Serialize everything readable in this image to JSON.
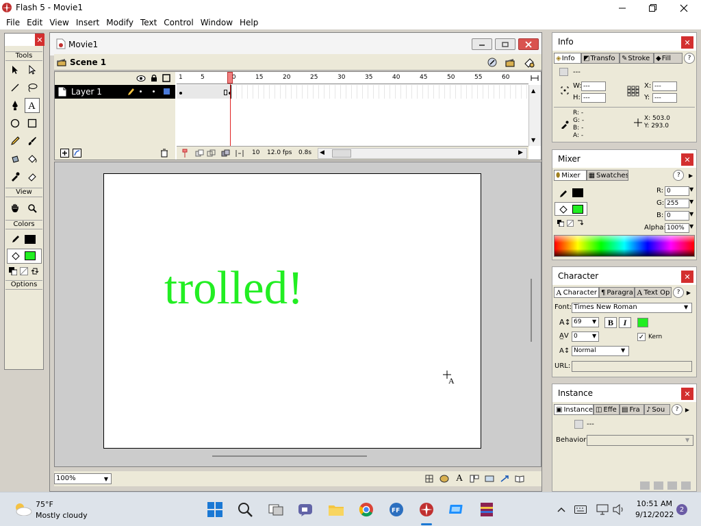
{
  "app": {
    "title": "Flash 5 - Movie1"
  },
  "menu": [
    "File",
    "Edit",
    "View",
    "Insert",
    "Modify",
    "Text",
    "Control",
    "Window",
    "Help"
  ],
  "tools": {
    "title": "Tools",
    "sections": {
      "view": "View",
      "colors": "Colors",
      "options": "Options"
    },
    "stroke_color": "#000000",
    "fill_color": "#22ee22"
  },
  "movie": {
    "title": "Movie1",
    "scene": "Scene 1",
    "layer": "Layer 1",
    "ruler_ticks": [
      "1",
      "5",
      "10",
      "15",
      "20",
      "25",
      "30",
      "35",
      "40",
      "45",
      "50",
      "55",
      "60"
    ],
    "current_frame": "10",
    "fps": "12.0 fps",
    "time": "0.8s",
    "zoom": "100%",
    "stage_text": "trolled!"
  },
  "info": {
    "title": "Info",
    "tabs": [
      "Info",
      "Transfo",
      "Stroke",
      "Fill"
    ],
    "shape": "---",
    "w_label": "W:",
    "w": "---",
    "h_label": "H:",
    "h": "---",
    "x_label": "X:",
    "x": "---",
    "y_label": "Y:",
    "y": "---",
    "r": "R: -",
    "g": "G: -",
    "b": "B: -",
    "a": "A: -",
    "cx": "X:  503.0",
    "cy": "Y:  293.0"
  },
  "mixer": {
    "title": "Mixer",
    "tabs": [
      "Mixer",
      "Swatches"
    ],
    "r_label": "R:",
    "r": "0",
    "g_label": "G:",
    "g": "255",
    "b_label": "B:",
    "b": "0",
    "alpha_label": "Alpha:",
    "alpha": "100%",
    "stroke_color": "#000000",
    "fill_color": "#22ee22"
  },
  "character": {
    "title": "Character",
    "tabs": [
      "Character",
      "Paragra",
      "Text Op"
    ],
    "font_label": "Font:",
    "font": "Times New Roman",
    "size": "69",
    "bold": "B",
    "italic": "I",
    "text_color": "#22ee22",
    "tracking": "0",
    "kern": "Kern",
    "baseline": "Normal",
    "url_label": "URL:"
  },
  "instance": {
    "title": "Instance",
    "tabs": [
      "Instance",
      "Effe",
      "Fra",
      "Sou"
    ],
    "symbol": "---",
    "behavior_label": "Behavior:"
  },
  "taskbar": {
    "temp": "75°F",
    "weather": "Mostly cloudy",
    "time": "10:51 AM",
    "date": "9/12/2022",
    "badge": "2"
  }
}
